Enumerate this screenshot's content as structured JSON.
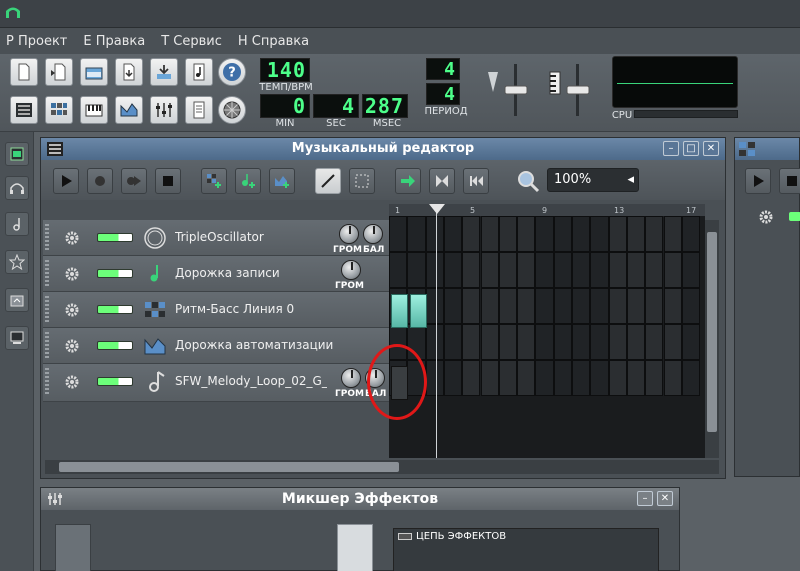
{
  "menu": [
    "Р Проект",
    "Е Правка",
    "Т Сервис",
    "Н Справка"
  ],
  "toolbar": {
    "tempo_value": "140",
    "tempo_label": "ТЕМП/BPM",
    "min_value": "0",
    "min_label": "MIN",
    "sec_value": "4",
    "sec_label": "SEC",
    "msec_value": "287",
    "msec_label": "MSEC",
    "sig_top": "4",
    "sig_bottom": "4",
    "period_label": "ПЕРИОД",
    "cpu_label": "CPU"
  },
  "song_editor": {
    "title": "Музыкальный редактор",
    "zoom": "100%",
    "ruler_ticks": [
      "1",
      "5",
      "9",
      "13",
      "17"
    ],
    "tracks": [
      {
        "name": "TripleOscillator",
        "icon": "triple-oscillator-icon",
        "knob1": "ГРОМ",
        "knob2": "БАЛ"
      },
      {
        "name": "Дорожка записи",
        "icon": "note-icon",
        "knob1": "ГРОМ",
        "knob2": ""
      },
      {
        "name": "Ритм-Басс Линия 0",
        "icon": "beat-bass-icon",
        "knob1": "",
        "knob2": ""
      },
      {
        "name": "Дорожка автоматизации",
        "icon": "automation-icon",
        "knob1": "",
        "knob2": ""
      },
      {
        "name": "SFW_Melody_Loop_02_G_",
        "icon": "sample-note-icon",
        "knob1": "ГРОМ",
        "knob2": "БАЛ"
      }
    ]
  },
  "mixer": {
    "title": "Микшер Эффектов",
    "fx_chain_label": "ЦЕПЬ ЭФФЕКТОВ"
  },
  "colors": {
    "lcd_green": "#4dff8a",
    "pattern_teal": "#7fd8c6",
    "annotation_red": "#e01818",
    "title_blue": "#5a7a9a"
  }
}
